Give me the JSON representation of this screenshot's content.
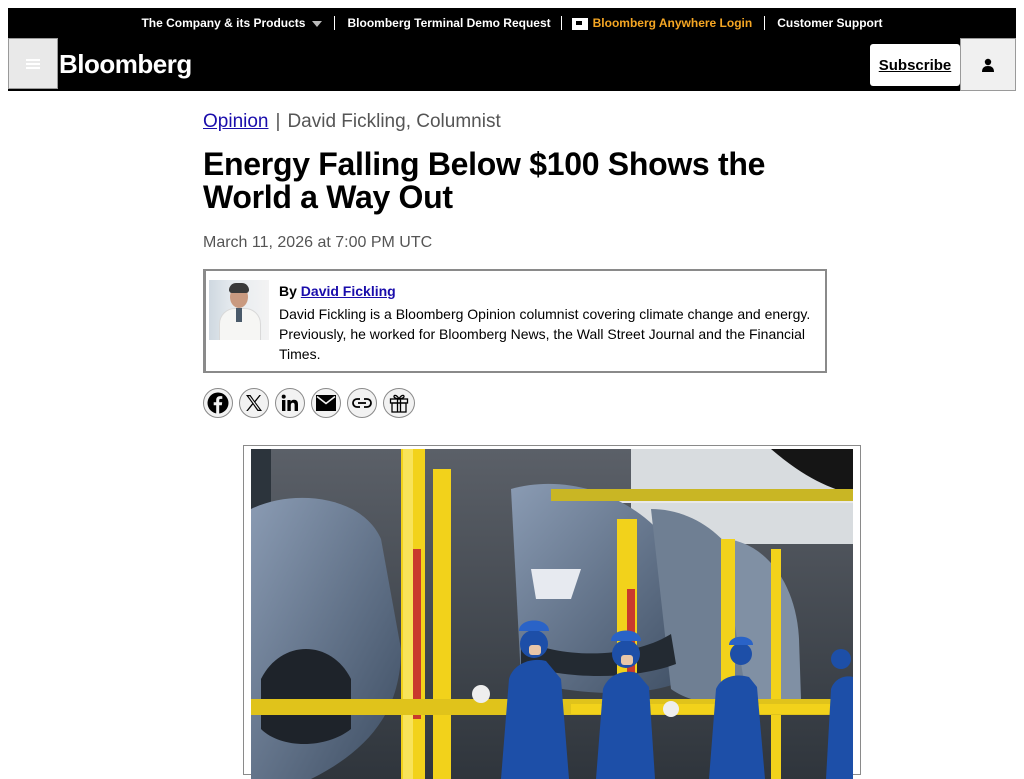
{
  "topnav": {
    "company_products": "The Company & its Products",
    "terminal_demo": "Bloomberg Terminal Demo Request",
    "anywhere_login": "Bloomberg Anywhere Login",
    "customer_support": "Customer Support"
  },
  "header": {
    "logo": "Bloomberg",
    "subscribe": "Subscribe"
  },
  "article": {
    "section": "Opinion",
    "byline_name": "David Fickling, Columnist",
    "headline": "Energy Falling Below $100 Shows the World a Way Out",
    "date": "March 11, 2026 at 7:00 PM UTC",
    "author": {
      "by_prefix": "By",
      "name": "David Fickling",
      "bio": "David Fickling is a Bloomberg Opinion columnist covering climate change and energy. Previously, he worked for Bloomberg News, the Wall Street Journal and the Financial Times."
    }
  },
  "share": {
    "icons": [
      "facebook-icon",
      "x-icon",
      "linkedin-icon",
      "email-icon",
      "link-icon",
      "gift-icon"
    ]
  },
  "colors": {
    "header_bg": "#000000",
    "accent_orange": "#f5a623",
    "link_blue": "#1a0dab",
    "hero_yellow": "#f2d21b",
    "worker_blue": "#1d4fa8"
  }
}
